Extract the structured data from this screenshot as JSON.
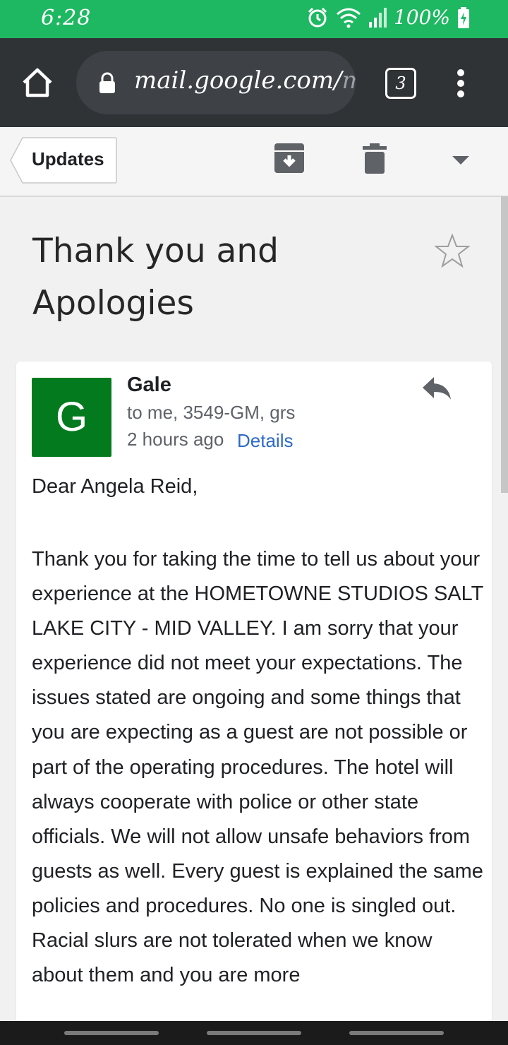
{
  "status_bar": {
    "time": "6:28",
    "battery": "100%",
    "icons": [
      "alarm-icon",
      "wifi-icon",
      "signal-icon",
      "battery-charging-icon"
    ]
  },
  "browser": {
    "url_main": "mail.google.com/",
    "url_faded": "m",
    "tab_count": "3",
    "icons": [
      "home-icon",
      "lock-icon",
      "tabs-icon",
      "overflow-menu-icon"
    ]
  },
  "toolbar": {
    "back_label": "Updates",
    "icons": [
      "archive-icon",
      "trash-icon",
      "dropdown-icon"
    ]
  },
  "email": {
    "subject": "Thank you and Apologies",
    "sender_initial": "G",
    "sender": "Gale",
    "recipients": "to me, 3549-GM, grs",
    "time": "2 hours ago",
    "details_link": "Details",
    "greeting": "Dear Angela Reid,",
    "body": "Thank you for taking the time to tell us about your experience at the HOMETOWNE STUDIOS SALT LAKE CITY - MID VALLEY. I am sorry that your experience did not meet your expectations. The issues stated are ongoing and some things that you are expecting as a guest are not possible or part of the operating procedures. The hotel will always cooperate with police or other state officials. We will not allow unsafe behaviors from guests as well. Every guest is explained the same policies and procedures. No one is singled out. Racial slurs are not tolerated when we know about them and you are more"
  },
  "colors": {
    "status_bar": "#1fb862",
    "browser_bar": "#303336",
    "avatar": "#047a1e",
    "link": "#2d69c7"
  }
}
